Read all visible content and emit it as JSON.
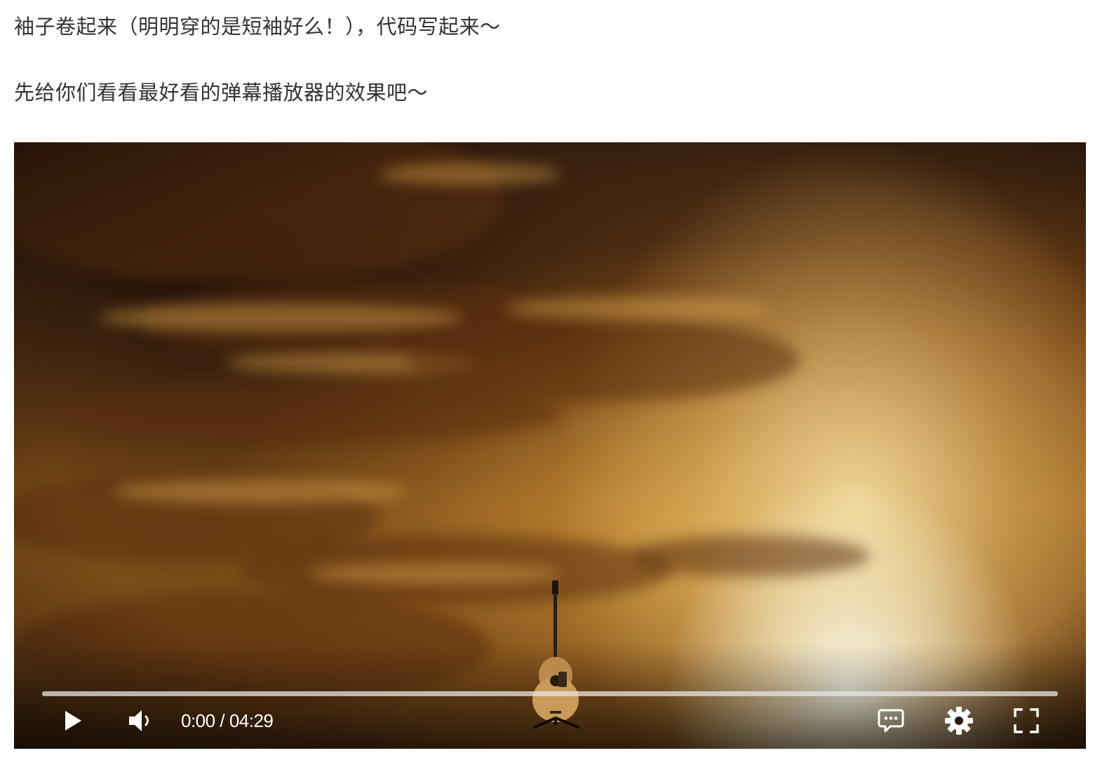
{
  "article": {
    "paragraphs": [
      "袖子卷起来（明明穿的是短袖好么！），代码写起来～",
      "先给你们看看最好看的弹幕播放器的效果吧～"
    ]
  },
  "player": {
    "current_time": "0:00",
    "separator": "/",
    "duration": "04:29",
    "progress": 0,
    "accent_color": "#00a1d6",
    "icons": {
      "play": "play-icon",
      "volume": "volume-icon",
      "danmaku": "danmaku-icon",
      "settings": "gear-icon",
      "fullscreen": "fullscreen-icon"
    }
  }
}
